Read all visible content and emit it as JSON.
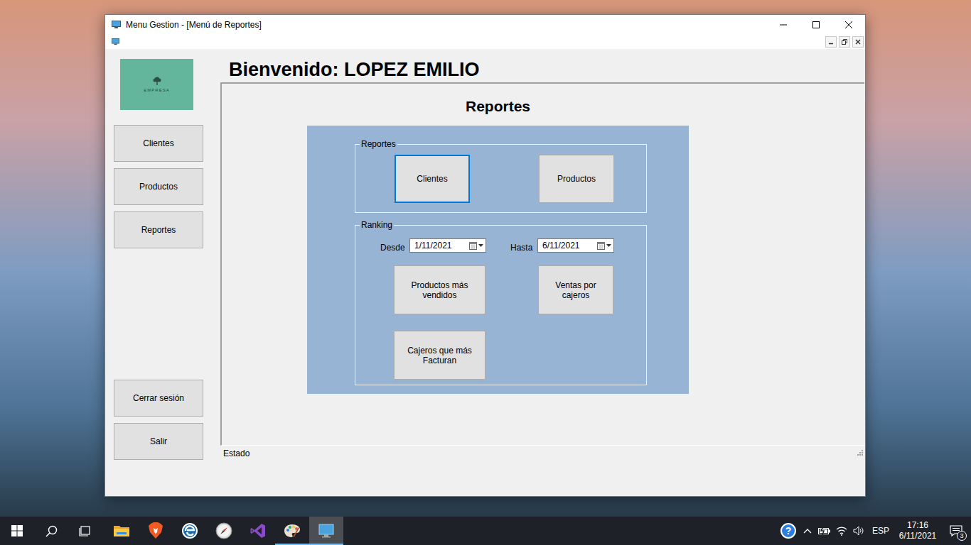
{
  "window": {
    "title": "Menu Gestion - [Menú de Reportes]"
  },
  "logo": {
    "text": "EMPRESA"
  },
  "welcome": "Bienvenido: LOPEZ EMILIO",
  "sidebar": {
    "items": [
      {
        "label": "Clientes"
      },
      {
        "label": "Productos"
      },
      {
        "label": "Reportes"
      }
    ],
    "bottom": [
      {
        "label": "Cerrar sesión"
      },
      {
        "label": "Salir"
      }
    ]
  },
  "panel_title": "Reportes",
  "reports_group": {
    "label": "Reportes",
    "buttons": [
      {
        "label": "Clientes",
        "selected": true
      },
      {
        "label": "Productos",
        "selected": false
      }
    ]
  },
  "ranking_group": {
    "label": "Ranking",
    "from": {
      "label": "Desde",
      "value": "1/11/2021"
    },
    "to": {
      "label": "Hasta",
      "value": "6/11/2021"
    },
    "buttons": [
      "Productos más vendidos",
      "Ventas por cajeros",
      "Cajeros que más Facturan"
    ]
  },
  "status_bar": "Estado",
  "taskbar": {
    "apps": [
      {
        "kind": "explorer",
        "running": false,
        "selected": false
      },
      {
        "kind": "brave",
        "running": false,
        "selected": false
      },
      {
        "kind": "browser",
        "running": false,
        "selected": false
      },
      {
        "kind": "compass",
        "running": false,
        "selected": false
      },
      {
        "kind": "studio",
        "running": false,
        "selected": false
      },
      {
        "kind": "paint",
        "running": true,
        "selected": false
      },
      {
        "kind": "app",
        "running": true,
        "selected": true
      }
    ],
    "tray": {
      "help": "?",
      "language": "ESP",
      "time": "17:16",
      "date": "6/11/2021",
      "notifications": "3"
    }
  }
}
